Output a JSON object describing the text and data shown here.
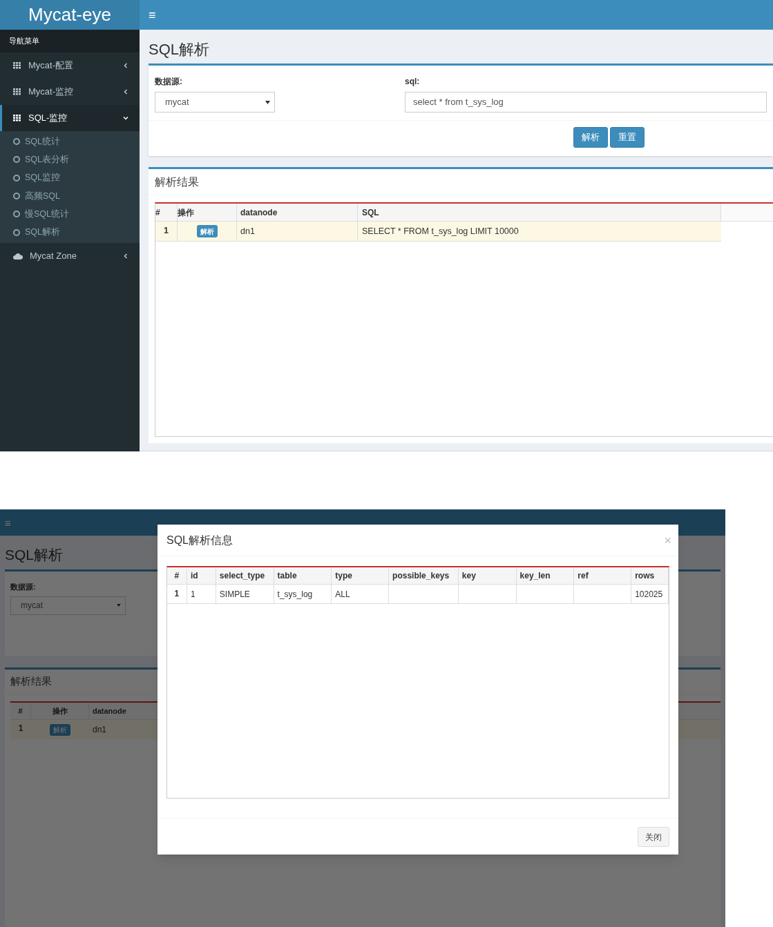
{
  "main_screen": {
    "logo": "Mycat-eye",
    "menu_toggle": "≡",
    "nav_header": "导航菜单",
    "sidebar": {
      "items": [
        {
          "label": "Mycat-配置",
          "kind": "grid",
          "expanded": false,
          "selected": false
        },
        {
          "label": "Mycat-监控",
          "kind": "grid",
          "expanded": false,
          "selected": false
        },
        {
          "label": "SQL-监控",
          "kind": "grid",
          "expanded": true,
          "selected": true,
          "children": [
            {
              "label": "SQL统计"
            },
            {
              "label": "SQL表分析"
            },
            {
              "label": "SQL监控"
            },
            {
              "label": "高频SQL"
            },
            {
              "label": "慢SQL统计"
            },
            {
              "label": "SQL解析"
            }
          ]
        },
        {
          "label": "Mycat Zone",
          "kind": "cloud",
          "expanded": false,
          "selected": false
        }
      ]
    },
    "page_title": "SQL解析",
    "form": {
      "datasource_label": "数据源:",
      "datasource_value": "mycat",
      "sql_label": "sql:",
      "sql_value": "select * from t_sys_log",
      "buttons": [
        "解析",
        "重置"
      ]
    },
    "results": {
      "title": "解析结果",
      "columns": [
        "#",
        "操作",
        "datanode",
        "SQL"
      ],
      "rows": [
        {
          "index": "1",
          "action": "解析",
          "datanode": "dn1",
          "sql": "SELECT * FROM t_sys_log LIMIT 10000",
          "highlighted": true
        }
      ]
    }
  },
  "modal_screen": {
    "background": {
      "menu_toggle": "≡",
      "page_title": "SQL解析",
      "datasource_label": "数据源:",
      "datasource_value": "mycat",
      "results_title": "解析结果",
      "columns": [
        "#",
        "操作",
        "datanode"
      ],
      "row": {
        "index": "1",
        "action": "解析",
        "datanode": "dn1"
      }
    },
    "modal": {
      "title": "SQL解析信息",
      "close": "×",
      "columns": [
        "#",
        "id",
        "select_type",
        "table",
        "type",
        "possible_keys",
        "key",
        "key_len",
        "ref",
        "rows"
      ],
      "rows": [
        {
          "cells": [
            "1",
            "1",
            "SIMPLE",
            "t_sys_log",
            "ALL",
            null,
            null,
            null,
            null,
            "102025"
          ]
        }
      ],
      "close_button": "关闭"
    }
  }
}
